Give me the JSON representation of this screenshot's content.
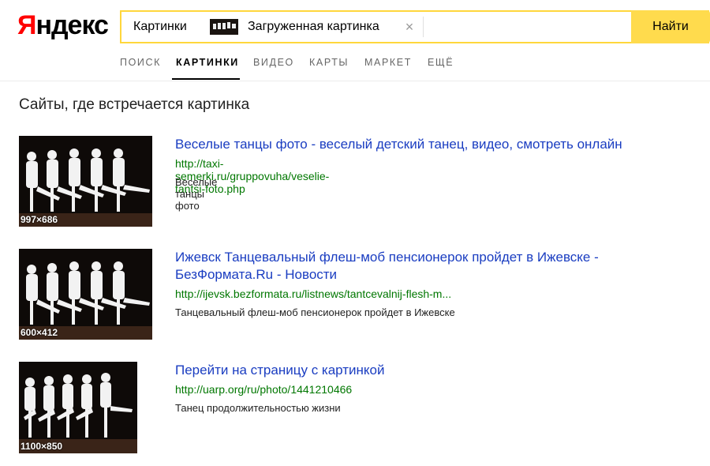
{
  "logo": {
    "first_letter": "Я",
    "rest": "ндекс"
  },
  "search": {
    "service": "Картинки",
    "uploaded_label": "Загруженная картинка",
    "clear_symbol": "×",
    "button_label": "Найти"
  },
  "nav": {
    "tabs": [
      {
        "label": "ПОИСК",
        "active": false
      },
      {
        "label": "КАРТИНКИ",
        "active": true
      },
      {
        "label": "ВИДЕО",
        "active": false
      },
      {
        "label": "КАРТЫ",
        "active": false
      },
      {
        "label": "МАРКЕТ",
        "active": false
      },
      {
        "label": "ЕЩЁ",
        "active": false
      }
    ]
  },
  "section_title": "Сайты, где встречается картинка",
  "results": [
    {
      "title": "Веселые танцы фото - веселый детский танец, видео, смотреть онлайн",
      "url": "http://taxi-semerki.ru/gruppovuha/veselie-tantsi-foto.php",
      "snippet": "Веселые танцы фото",
      "size": "997×686"
    },
    {
      "title_line1": "Ижевск Танцевальный флеш-моб пенсионерок пройдет в Ижевске -",
      "title_line2": "БезФормата.Ru - Новости",
      "url": "http://ijevsk.bezformata.ru/listnews/tantcevalnij-flesh-m...",
      "snippet": "Танцевальный флеш-моб пенсионерок пройдет в Ижевске",
      "size": "600×412"
    },
    {
      "title": "Перейти на страницу с картинкой",
      "url": "http://uarp.org/ru/photo/1441210466",
      "snippet": "Танец продолжительностью жизни",
      "size": "1100×850"
    }
  ],
  "colors": {
    "accent_yellow": "#ffdb4d",
    "logo_red": "#ff0000",
    "link_blue": "#1a3dc1",
    "url_green": "#007700"
  }
}
